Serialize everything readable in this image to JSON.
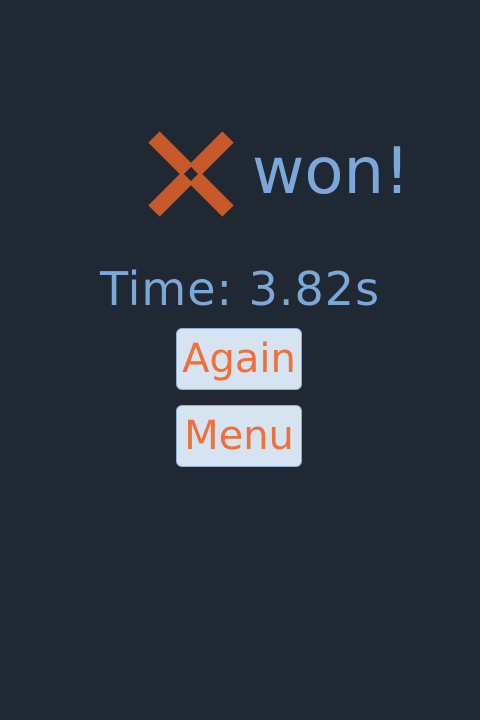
{
  "result": {
    "winner_icon": "x-mark-icon",
    "winner_color": "#c8592a",
    "won_label": "won!"
  },
  "stats": {
    "time_label": "Time: 3.82s"
  },
  "buttons": {
    "again_label": "Again",
    "menu_label": "Menu"
  },
  "colors": {
    "background": "#1f2833",
    "text": "#7aa8d8",
    "button_bg": "#d6e3f0",
    "button_text": "#f0703a"
  }
}
